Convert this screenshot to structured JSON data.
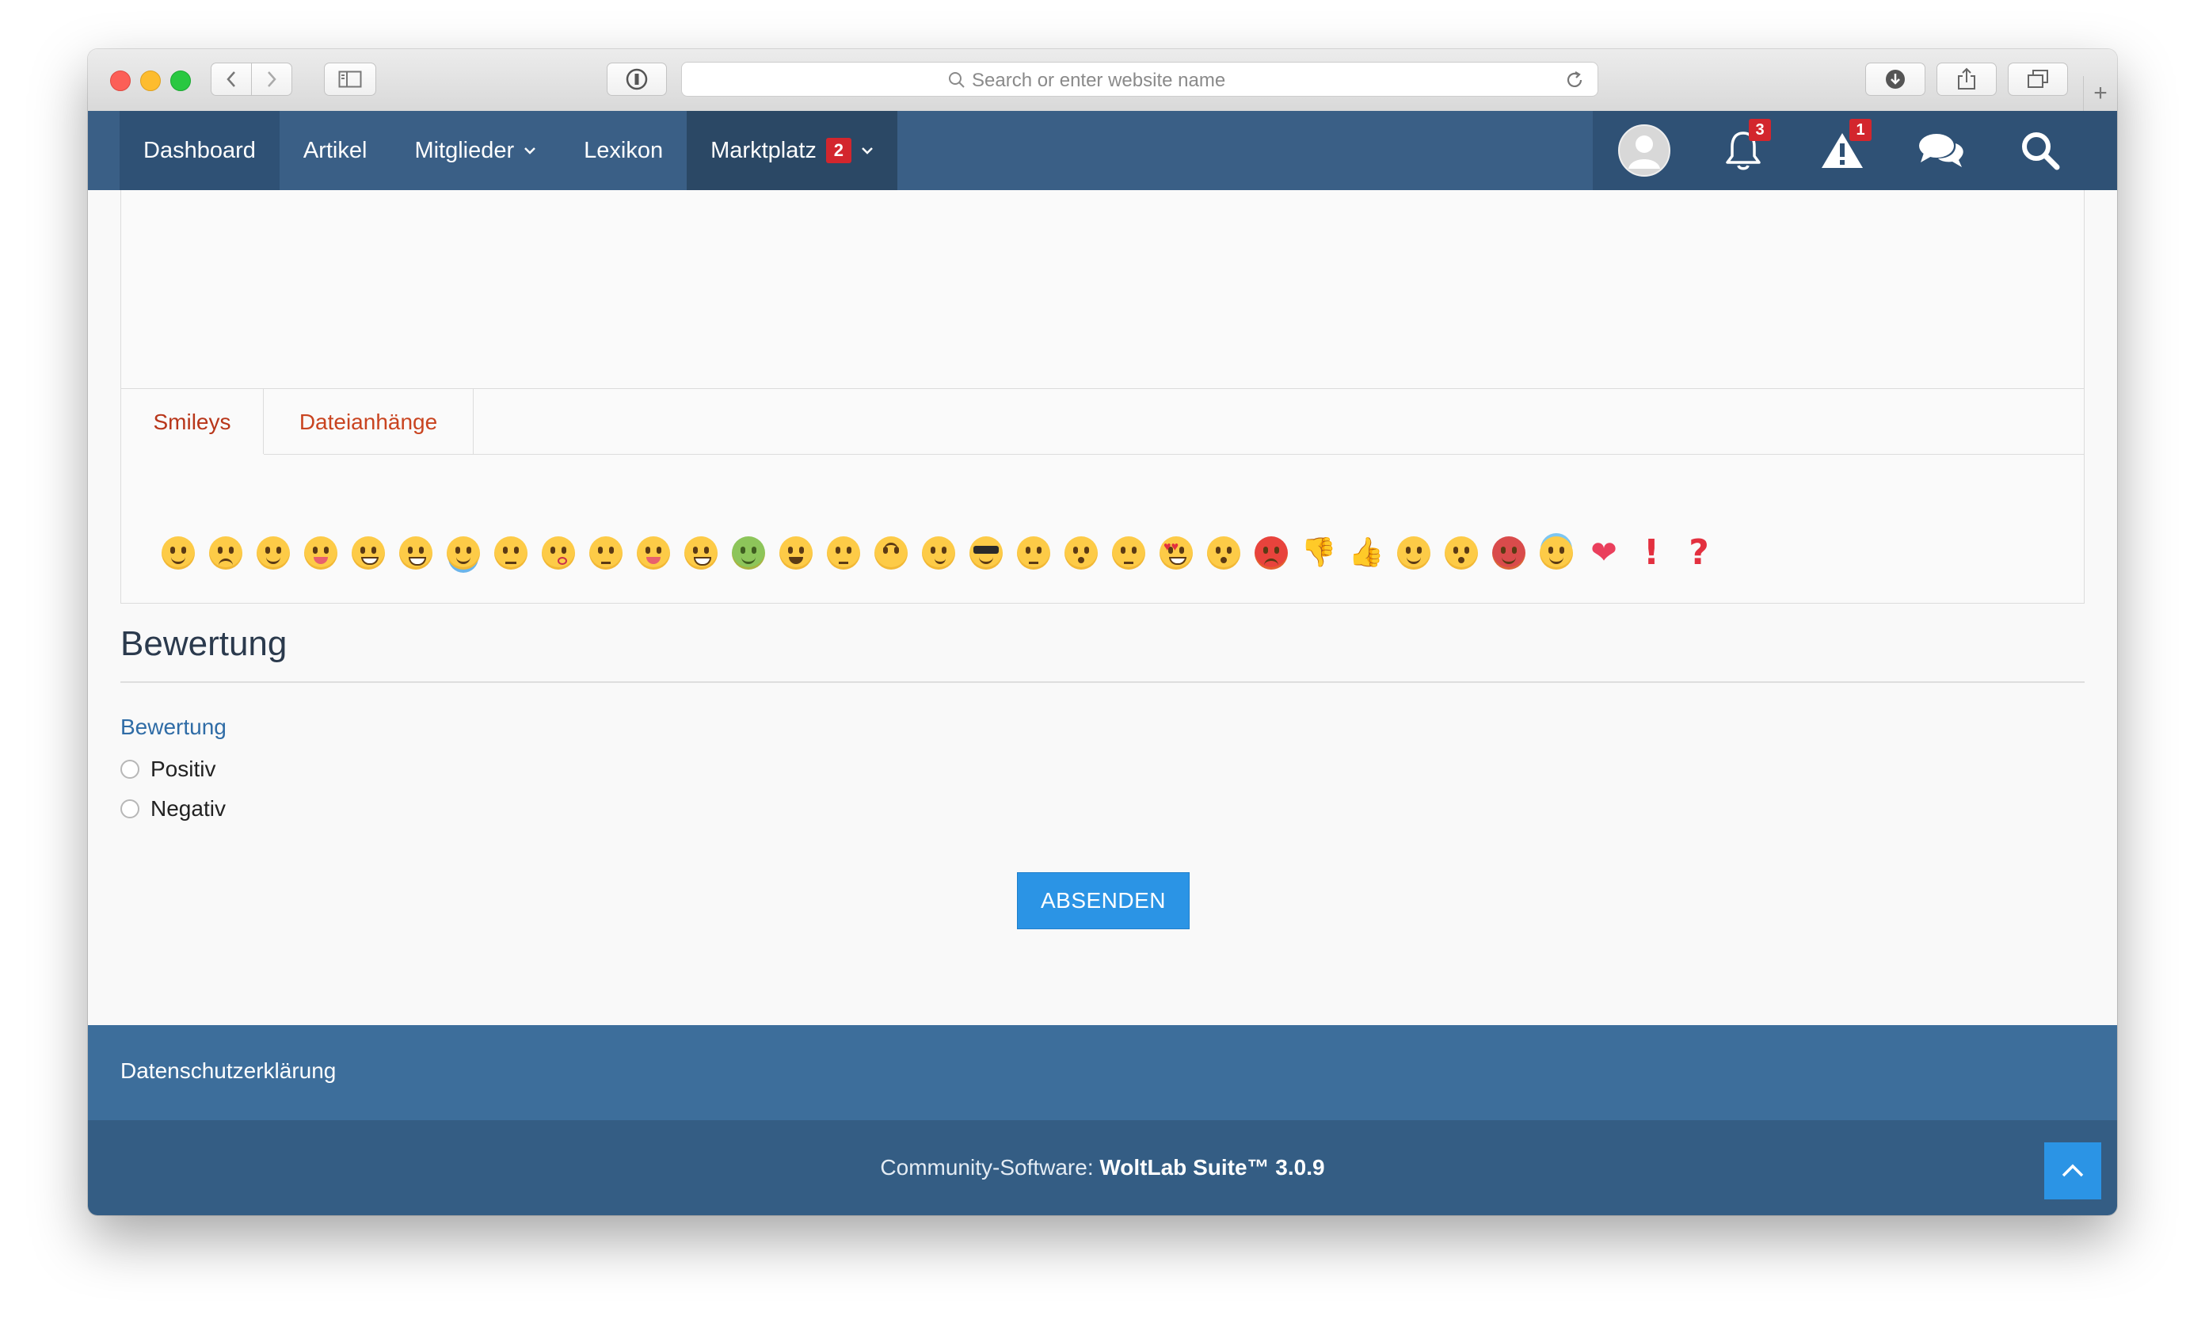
{
  "browser": {
    "url_placeholder": "Search or enter website name"
  },
  "nav": {
    "items": [
      {
        "label": "Dashboard"
      },
      {
        "label": "Artikel"
      },
      {
        "label": "Mitglieder"
      },
      {
        "label": "Lexikon"
      },
      {
        "label": "Marktplatz",
        "badge": "2"
      }
    ],
    "notifications_badge": "3",
    "moderation_badge": "1"
  },
  "editor": {
    "tabs": [
      "Smileys",
      "Dateianhänge"
    ],
    "smileys": [
      "smile-icon",
      "frown-icon",
      "wink-icon",
      "tongue-icon",
      "grin-icon",
      "laughing-icon",
      "crying-icon",
      "unamused-icon",
      "kiss-icon",
      "confused-icon",
      "crazy-icon",
      "flushed-icon",
      "sick-icon",
      "tired-icon",
      "thinking-icon",
      "upside-down-icon",
      "smirk-icon",
      "cool-icon",
      "neutral-icon",
      "surprised-icon",
      "eye-roll-icon",
      "heart-eyes-icon",
      "astonished-icon",
      "angry-icon",
      "thumbs-down-icon",
      "thumbs-up-icon",
      "sleepy-icon",
      "whistling-icon",
      "devil-icon",
      "angel-icon",
      "heart-icon",
      "exclamation-icon",
      "question-icon"
    ]
  },
  "rating": {
    "section_title": "Bewertung",
    "field_label": "Bewertung",
    "options": [
      "Positiv",
      "Negativ"
    ],
    "submit_label": "ABSENDEN"
  },
  "footer": {
    "privacy_link": "Datenschutzerklärung",
    "copyright_prefix": "Community-Software: ",
    "copyright_product": "WoltLab Suite™ 3.0.9"
  },
  "colors": {
    "nav_bg": "#3a5f86",
    "footer_bg": "#3d6e9b",
    "footer_bottom_bg": "#345d84",
    "accent_button": "#2b94e5",
    "badge_red": "#d3262d",
    "tab_text": "#c94420"
  }
}
